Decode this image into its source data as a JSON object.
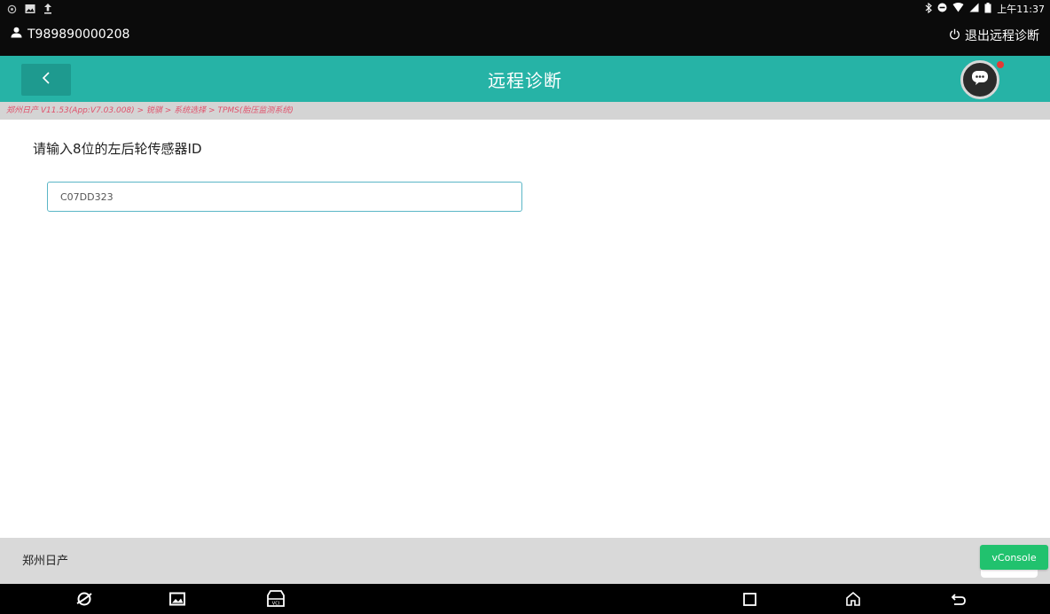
{
  "status_bar": {
    "left_icons": [
      "settings-icon",
      "image-icon",
      "upload-icon"
    ],
    "right_icons": [
      "bluetooth-icon",
      "do-not-disturb-icon",
      "wifi-icon",
      "signal-icon",
      "battery-icon"
    ],
    "time": "上午11:37"
  },
  "session": {
    "user_id": "T989890000208",
    "exit_label": "退出远程诊断"
  },
  "header": {
    "title": "远程诊断"
  },
  "breadcrumb": "郑州日产 V11.53(App:V7.03.008) > 锐骐 > 系统选择 > TPMS(胎压监测系统)",
  "content": {
    "prompt": "请输入8位的左后轮传感器ID",
    "sensor_id_value": "C07DD323"
  },
  "footer": {
    "label": "郑州日产",
    "vconsole_label": "vConsole"
  },
  "colors": {
    "header_bg": "#26b3a6",
    "breadcrumb_text": "#e0516b",
    "vconsole_bg": "#21c26e"
  }
}
